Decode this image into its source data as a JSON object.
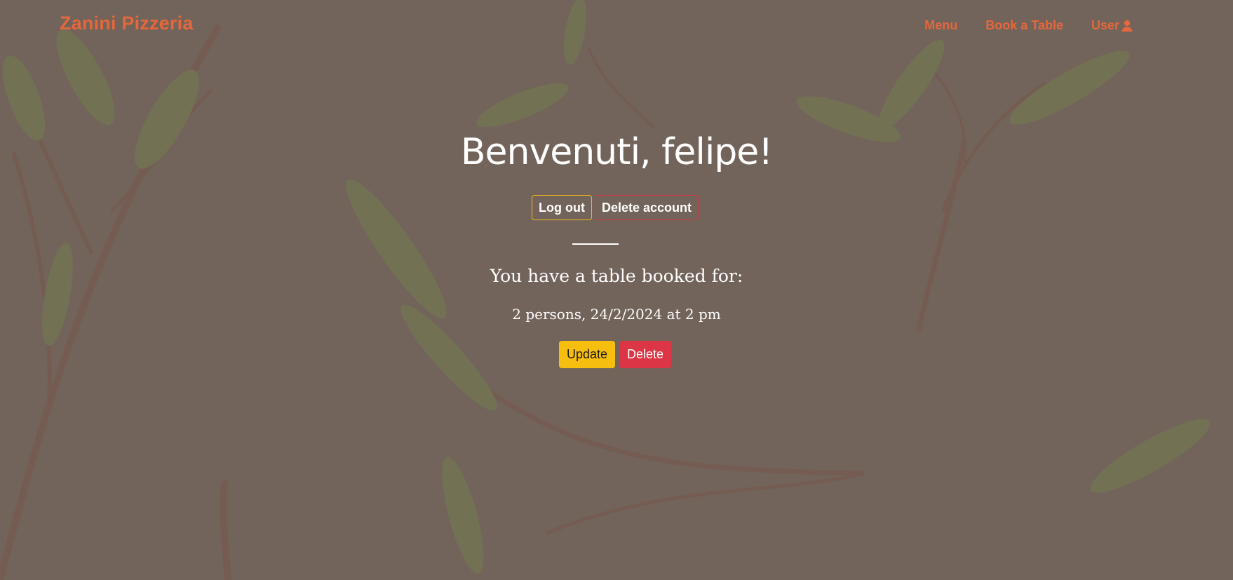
{
  "navbar": {
    "brand": "Zanini Pizzeria",
    "links": [
      {
        "label": "Menu"
      },
      {
        "label": "Book a Table"
      },
      {
        "label": "User",
        "icon": "user-icon"
      }
    ]
  },
  "hero": {
    "welcome": "Benvenuti, felipe!",
    "account_actions": {
      "logout_label": "Log out",
      "delete_account_label": "Delete account"
    },
    "booking": {
      "label": "You have a table booked for:",
      "details": "2 persons, 24/2/2024 at 2 pm",
      "update_label": "Update",
      "delete_label": "Delete"
    }
  },
  "theme": {
    "accent": "#e4673d",
    "warning": "#f6bf10",
    "danger": "#dc3545",
    "overlay": "#77695f"
  }
}
